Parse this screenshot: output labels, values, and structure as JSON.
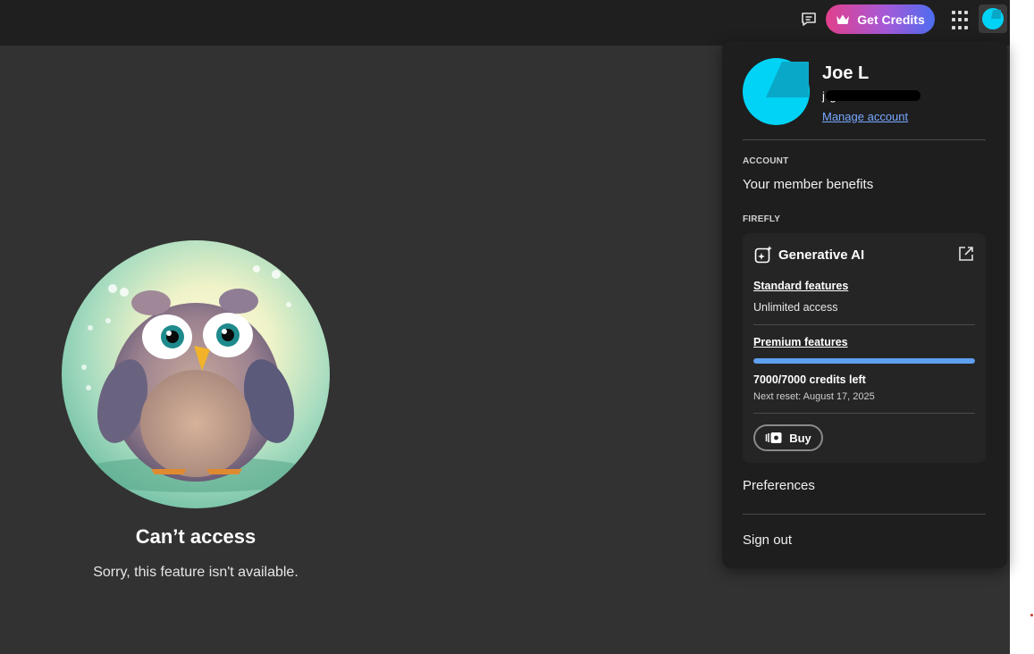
{
  "header": {
    "get_credits_label": "Get Credits"
  },
  "error": {
    "title": "Can’t access",
    "message": "Sorry, this feature isn't available."
  },
  "account_panel": {
    "user_name": "Joe L",
    "email_visible": "j    g        m",
    "manage_account": "Manage account",
    "account_section": "ACCOUNT",
    "member_benefits": "Your member benefits",
    "firefly_section": "FIREFLY",
    "generative_ai": {
      "title": "Generative AI",
      "standard_features": "Standard features",
      "standard_access": "Unlimited access",
      "premium_features": "Premium features",
      "credits_used_fraction": 1.0,
      "credits_left": "7000/7000 credits left",
      "next_reset": "Next reset: August 17, 2025",
      "buy_label": "Buy"
    },
    "preferences": "Preferences",
    "sign_out": "Sign out"
  },
  "colors": {
    "accent_link": "#78a8ff",
    "avatar_cyan": "#00d3f5",
    "progress_blue": "#5fa0f0"
  }
}
